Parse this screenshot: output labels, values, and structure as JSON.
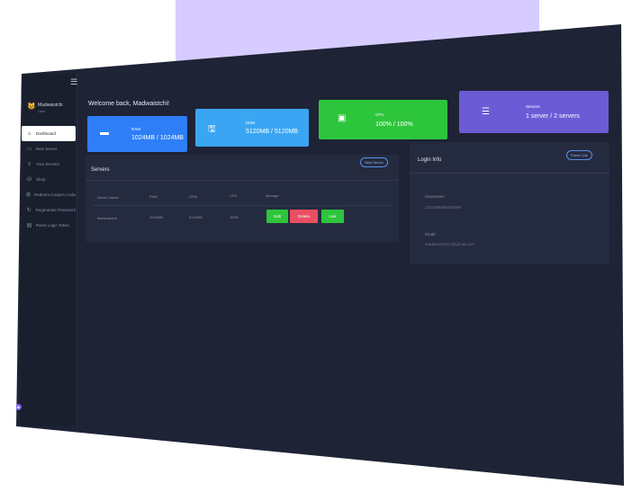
{
  "brand": {
    "accent": "#6b5cd6",
    "lavender": "#d7ccff"
  },
  "topbar": {
    "avatar_icon": "cat-icon"
  },
  "sidebar": {
    "menu_icon": "hamburger-icon",
    "user": {
      "name": "Madwaistchi",
      "role": "User"
    },
    "items": [
      {
        "label": "Dashboard",
        "icon": "home-icon",
        "active": true
      },
      {
        "label": "New Server",
        "icon": "server-icon",
        "active": false
      },
      {
        "label": "Your Servers",
        "icon": "list-icon",
        "active": false
      },
      {
        "label": "Shop",
        "icon": "shop-icon",
        "active": false
      },
      {
        "label": "Redeem Coupon Code",
        "icon": "coupon-icon",
        "active": false
      },
      {
        "label": "Regenerate Password",
        "icon": "refresh-icon",
        "active": false
      },
      {
        "label": "Panel Login Token",
        "icon": "document-icon",
        "active": false
      }
    ]
  },
  "main": {
    "welcome": "Welcome back, Madwaistchi!",
    "stats": [
      {
        "key": "ram",
        "label": "RAM",
        "value": "1024MB / 1024MB",
        "color": "#2d7ef7",
        "icon": "ram-icon"
      },
      {
        "key": "disk",
        "label": "DISK",
        "value": "5120MB / 5120MB",
        "color": "#3aa6f3",
        "icon": "disk-icon"
      },
      {
        "key": "cpu",
        "label": "CPU",
        "value": "100% / 100%",
        "color": "#2dc53b",
        "icon": "cpu-icon"
      },
      {
        "key": "servers",
        "label": "Servers",
        "value": "1 server / 2 servers",
        "color": "#6b5cd6",
        "icon": "servers-icon"
      }
    ],
    "servers_panel": {
      "title": "Servers",
      "new_button": "New Server",
      "columns": [
        "Server Name",
        "RAM",
        "DISK",
        "CPU",
        "Manage"
      ],
      "rows": [
        {
          "name": "Madwaistchi",
          "ram": "1024MB",
          "disk": "5120MB",
          "cpu": "100%",
          "actions": [
            "Edit",
            "Delete",
            "Link"
          ]
        }
      ]
    },
    "login_panel": {
      "title": "Login Info",
      "panel_button": "Panel Link",
      "username_label": "Username:",
      "username_value": "2233389366460298",
      "email_label": "Email:",
      "email_value": "madwaistchi14@gmail.com"
    }
  }
}
